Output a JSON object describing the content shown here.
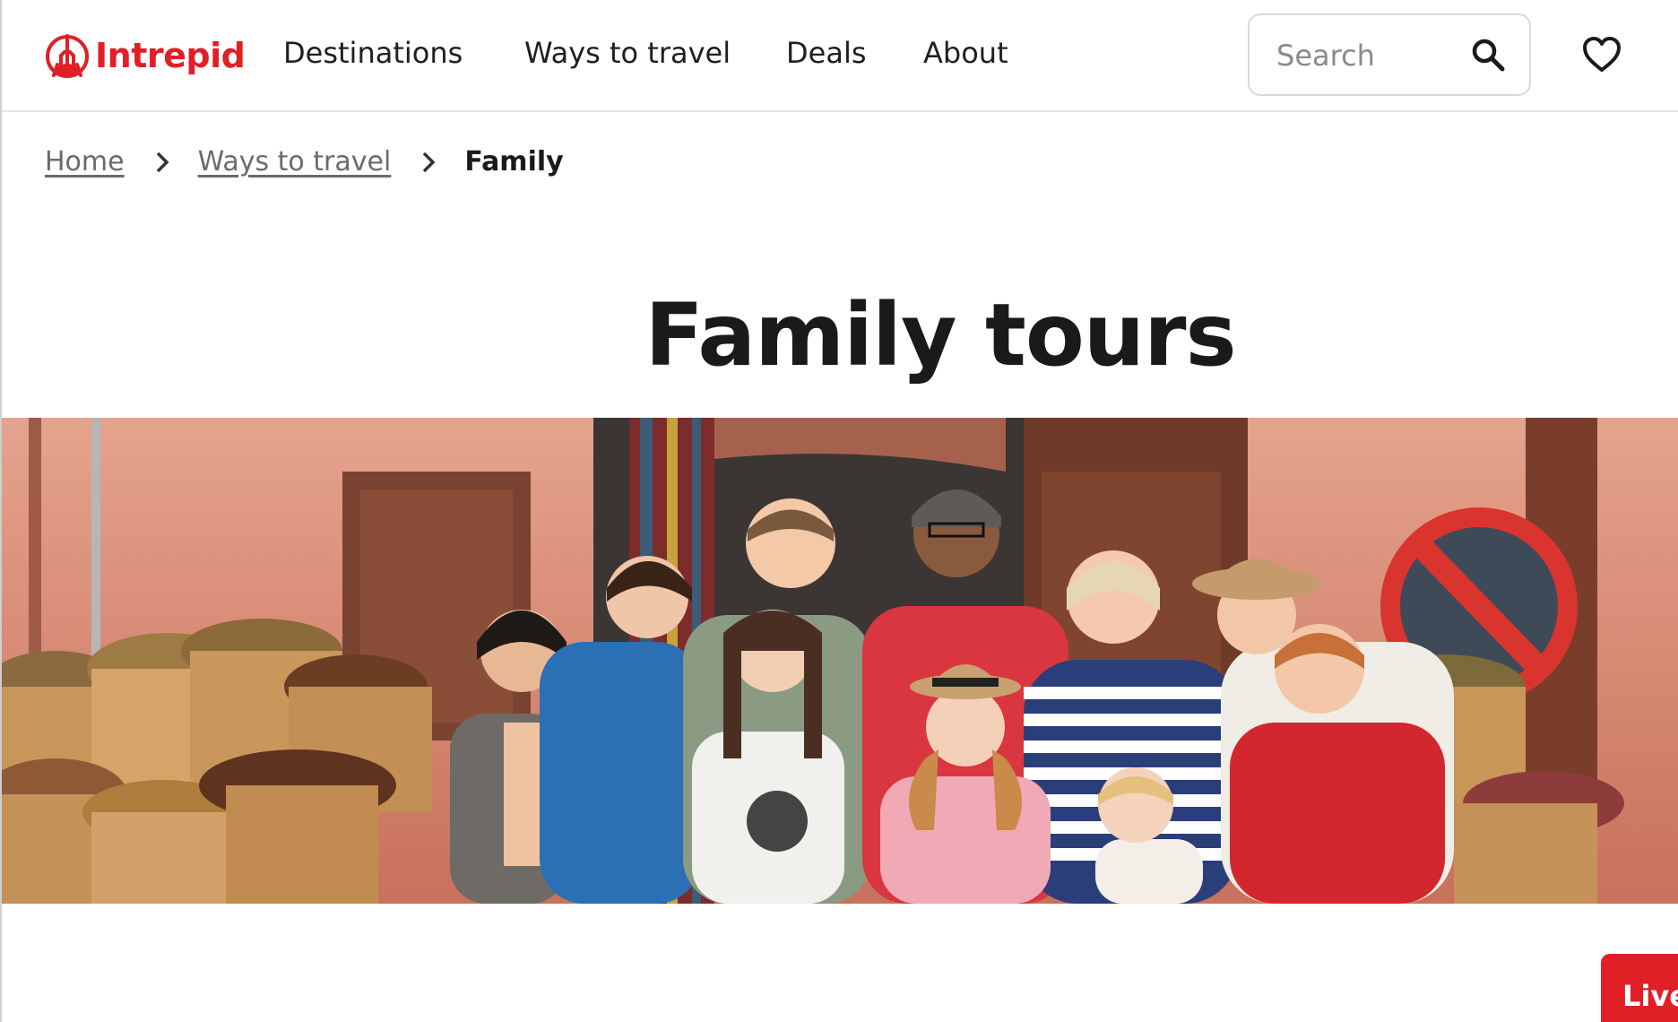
{
  "brand": {
    "name": "Intrepid",
    "logo_icon": "intrepid-logo-icon",
    "accent_color": "#e01f26"
  },
  "nav": {
    "items": [
      {
        "label": "Destinations"
      },
      {
        "label": "Ways to travel"
      },
      {
        "label": "Deals"
      },
      {
        "label": "About"
      }
    ]
  },
  "search": {
    "placeholder": "Search",
    "icon": "search-icon"
  },
  "wishlist": {
    "icon": "heart-icon"
  },
  "breadcrumb": {
    "items": [
      {
        "label": "Home"
      },
      {
        "label": "Ways to travel"
      },
      {
        "label": "Family"
      }
    ]
  },
  "page": {
    "title": "Family tours"
  },
  "hero": {
    "alt": "",
    "description": ""
  },
  "live_chat": {
    "label": "Live"
  }
}
